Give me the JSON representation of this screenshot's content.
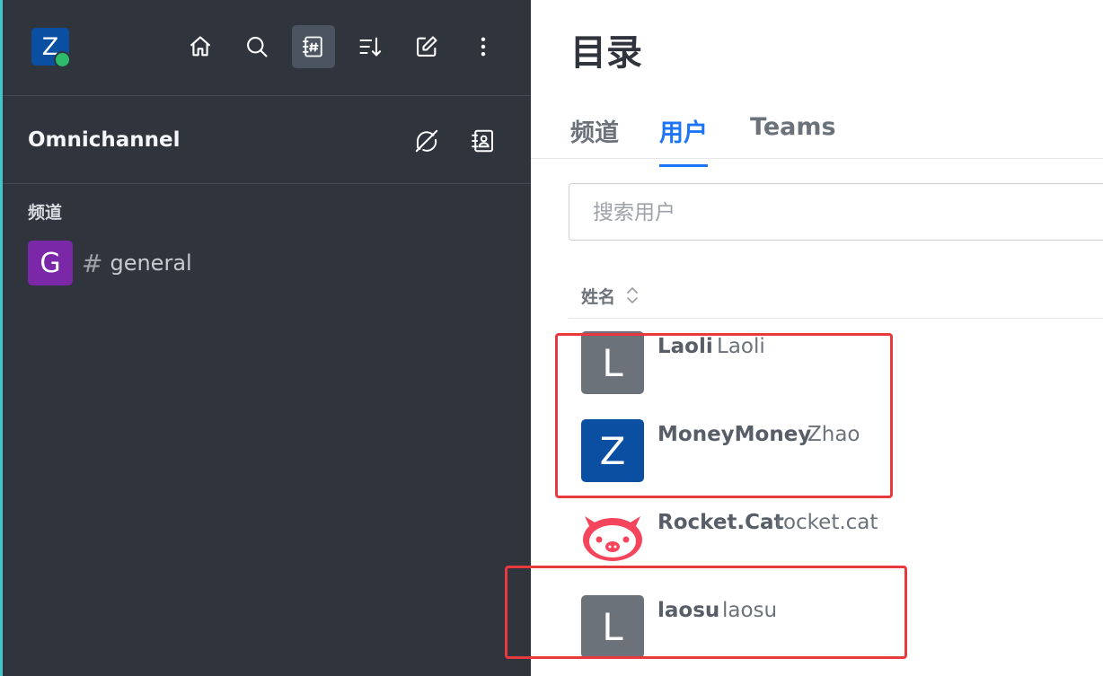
{
  "colors": {
    "sidebar_bg": "#2f343d",
    "accent_edge": "#3ec6c9",
    "active_tab": "#1d74f5",
    "status_online": "#2ebc6c",
    "highlight_box": "#e8393f"
  },
  "sidebar": {
    "user_avatar_initial": "Z",
    "toolbar": [
      {
        "icon": "home-icon"
      },
      {
        "icon": "search-icon"
      },
      {
        "icon": "directory-icon",
        "active": true
      },
      {
        "icon": "sort-icon"
      },
      {
        "icon": "create-new-icon"
      },
      {
        "icon": "kebab-menu-icon"
      }
    ],
    "omnichannel": {
      "title": "Omnichannel",
      "actions": [
        {
          "icon": "agent-offline-icon"
        },
        {
          "icon": "contact-center-icon"
        }
      ]
    },
    "section_label": "频道",
    "channels": [
      {
        "avatar_initial": "G",
        "hash": "#",
        "name": "general",
        "avatar_color": "#7a27a8"
      }
    ]
  },
  "main": {
    "title": "目录",
    "tabs": [
      {
        "label": "频道",
        "active": false
      },
      {
        "label": "用户",
        "active": true
      },
      {
        "label": "Teams",
        "active": false
      }
    ],
    "search": {
      "placeholder": "搜索用户",
      "value": ""
    },
    "column_header": "姓名",
    "users": [
      {
        "avatar_initial": "L",
        "name": "Laoli",
        "username": "Laoli",
        "avatar_color": "#6c727a"
      },
      {
        "avatar_initial": "Z",
        "name": "MoneyMoney",
        "username": "Zhao",
        "avatar_color": "#0b4fa3"
      },
      {
        "avatar_initial": "",
        "name": "Rocket.Cat",
        "username": "rocket.cat",
        "avatar_color": "#f5455c"
      },
      {
        "avatar_initial": "L",
        "name": "laosu",
        "username": "laosu",
        "avatar_color": "#6c727a"
      }
    ]
  }
}
